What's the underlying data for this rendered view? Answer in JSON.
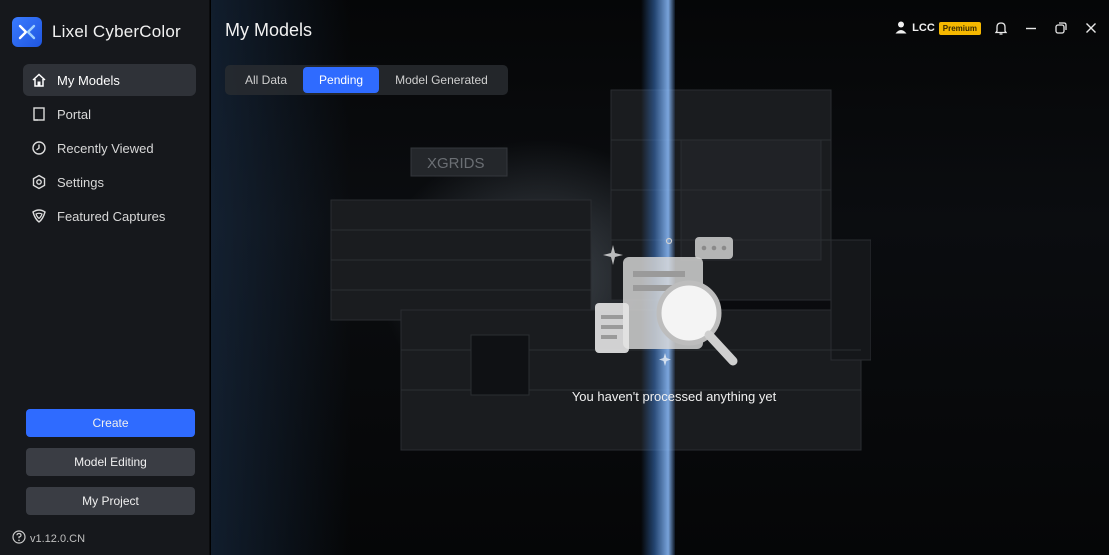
{
  "app": {
    "name": "Lixel CyberColor",
    "version": "v1.12.0.CN"
  },
  "sidebar": {
    "items": [
      {
        "label": "My Models",
        "icon": "home-icon"
      },
      {
        "label": "Portal",
        "icon": "bookmark-icon"
      },
      {
        "label": "Recently Viewed",
        "icon": "clock-icon"
      },
      {
        "label": "Settings",
        "icon": "gear-icon"
      },
      {
        "label": "Featured Captures",
        "icon": "heart-shield-icon"
      }
    ],
    "create_label": "Create",
    "editing_label": "Model Editing",
    "project_label": "My Project"
  },
  "main": {
    "title": "My Models",
    "tabs": [
      {
        "label": "All Data"
      },
      {
        "label": "Pending"
      },
      {
        "label": "Model Generated"
      }
    ],
    "active_tab": "Pending",
    "empty_message": "You haven't processed anything yet",
    "background_sign": "XGRIDS"
  },
  "topbar": {
    "user": "LCC",
    "badge": "Premium"
  },
  "colors": {
    "accent": "#2f6bff",
    "premium": "#f5b800",
    "sidebar": "#16181c"
  }
}
